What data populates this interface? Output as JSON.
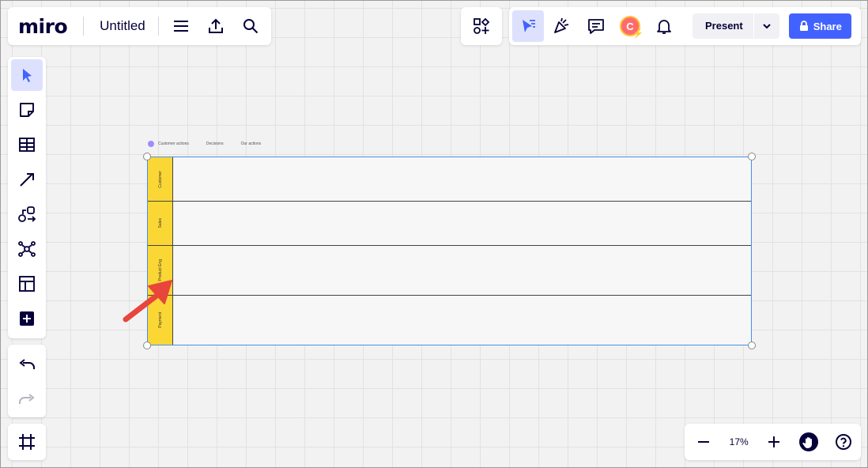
{
  "app": {
    "logo": "miro",
    "board_title": "Untitled"
  },
  "header": {
    "present_label": "Present",
    "share_label": "Share",
    "avatar_initial": "C"
  },
  "colors": {
    "accent": "#4262ff",
    "lane_label": "#fbd735",
    "avatar": "#ff6b6b"
  },
  "toolbar": {
    "tools": [
      {
        "name": "select-tool",
        "icon": "cursor-icon"
      },
      {
        "name": "sticky-note-tool",
        "icon": "sticky-note-icon"
      },
      {
        "name": "table-tool",
        "icon": "table-icon"
      },
      {
        "name": "connection-line-tool",
        "icon": "arrow-icon"
      },
      {
        "name": "shapes-tool",
        "icon": "shapes-icon"
      },
      {
        "name": "mind-map-tool",
        "icon": "mind-map-icon"
      },
      {
        "name": "templates-tool",
        "icon": "templates-icon"
      },
      {
        "name": "more-tools",
        "icon": "plus-icon"
      }
    ]
  },
  "board": {
    "legend": [
      "Customer actions",
      "Decisions",
      "Our actions"
    ],
    "lanes": [
      {
        "label": "Customer"
      },
      {
        "label": "Sales"
      },
      {
        "label": "Product Eng"
      },
      {
        "label": "Payment"
      }
    ]
  },
  "zoom": {
    "value": "17%"
  }
}
